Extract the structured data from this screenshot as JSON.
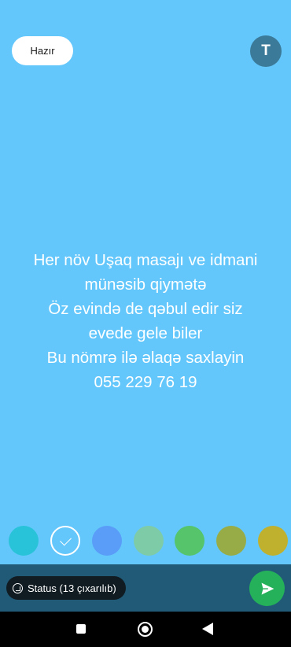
{
  "header": {
    "done_label": "Hazır",
    "text_tool_label": "T"
  },
  "message": {
    "lines": [
      "Her növ Uşaq masajı ve idmani",
      "münəsib qiymətə",
      "Öz evində de qəbul edir siz",
      "evede gele biler",
      "Bu nömrə ilə əlaqə saxlayin",
      "055 229 76 19"
    ]
  },
  "colors": {
    "background": "#64c7fb",
    "bottom_bar": "#205a77",
    "send_button": "#25b05a"
  },
  "palette": {
    "selected_index": 1,
    "swatches": [
      "#29c3d9",
      "#64c7fb",
      "#5a9df8",
      "#7ecba7",
      "#55c46a",
      "#97ac47",
      "#bfb12e"
    ]
  },
  "footer": {
    "status_label": "Status (13 çıxarılıb)",
    "status_icon": "status-ring-icon",
    "send_icon": "send-arrow-icon"
  },
  "navigation": {
    "recents_icon": "square-icon",
    "home_icon": "circle-icon",
    "back_icon": "triangle-back-icon"
  }
}
